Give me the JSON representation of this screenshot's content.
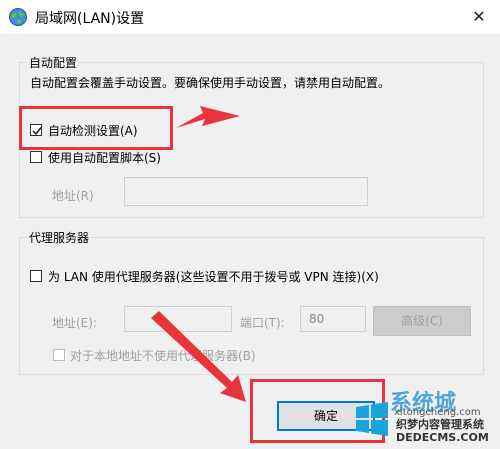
{
  "window": {
    "title": "局域网(LAN)设置",
    "close_glyph": "✕",
    "icon": "network-globe-icon"
  },
  "auto_config": {
    "group_title": "自动配置",
    "description": "自动配置会覆盖手动设置。要确保使用手动设置，请禁用自动配置。",
    "auto_detect_label": "自动检测设置(A)",
    "auto_detect_checked": true,
    "use_script_label": "使用自动配置脚本(S)",
    "use_script_checked": false,
    "address_label": "地址(R)",
    "address_value": ""
  },
  "proxy": {
    "group_title": "代理服务器",
    "use_proxy_label": "为 LAN 使用代理服务器(这些设置不用于拨号或 VPN 连接)(X)",
    "use_proxy_checked": false,
    "address_label": "地址(E):",
    "address_value": "",
    "port_label": "端口(T):",
    "port_value": "80",
    "advanced_label": "高级(C)",
    "bypass_label": "对于本地地址不使用代理服务器(B)",
    "bypass_checked": false
  },
  "buttons": {
    "ok_label": "确定"
  },
  "watermark": {
    "logo_text": "系统城",
    "site_top": "xitongcheng.com",
    "site_name": "织梦内容管理系统",
    "site_url": "DEDECMS.COM"
  },
  "colors": {
    "highlight": "#e8343c",
    "accent": "#0078d7",
    "dialog_bg": "#f0f0f0"
  }
}
